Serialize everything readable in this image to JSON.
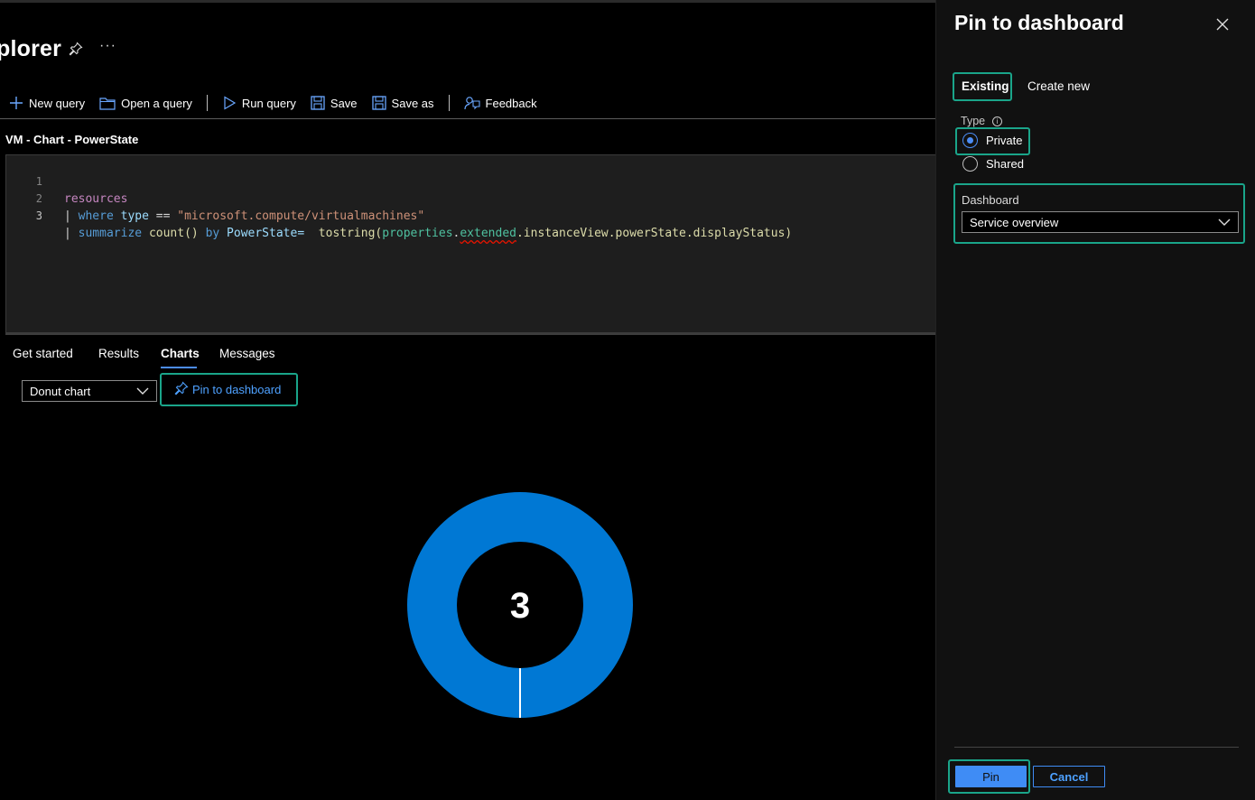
{
  "page": {
    "title": "plorer",
    "more_glyph": "···"
  },
  "toolbar": {
    "new_query": "New query",
    "open_query": "Open a query",
    "run_query": "Run query",
    "save": "Save",
    "save_as": "Save as",
    "feedback": "Feedback"
  },
  "query_tab": {
    "label": "VM - Chart - PowerState"
  },
  "editor": {
    "line_numbers": [
      "1",
      "2",
      "3"
    ],
    "line1": "resources",
    "line2": {
      "pipe": "|",
      "where": "where",
      "type": "type",
      "op": "==",
      "value": "\"microsoft.compute/virtualmachines\""
    },
    "line3": {
      "pipe": "|",
      "summarize": "summarize",
      "count": "count()",
      "by": "by",
      "alias": "PowerState=",
      "fn": "tostring(",
      "p1": "properties",
      "dot1": ".",
      "p2": "extended",
      "rest": ".instanceView.powerState.displayStatus)"
    }
  },
  "result_tabs": {
    "get_started": "Get started",
    "results": "Results",
    "charts": "Charts",
    "messages": "Messages",
    "active": "Charts"
  },
  "chart_controls": {
    "chart_type_value": "Donut chart",
    "pin_button": "Pin to dashboard"
  },
  "chart_data": {
    "type": "pie",
    "variant": "donut",
    "center_label": "3",
    "slices": [
      {
        "value": 3,
        "color": "#0078d4"
      }
    ]
  },
  "panel": {
    "title": "Pin to dashboard",
    "tabs": {
      "existing": "Existing",
      "create_new": "Create new",
      "active": "Existing"
    },
    "type_label": "Type",
    "type_options": {
      "private": "Private",
      "shared": "Shared",
      "selected": "Private"
    },
    "dashboard_label": "Dashboard",
    "dashboard_value": "Service overview",
    "pin_button": "Pin",
    "cancel_button": "Cancel"
  },
  "colors": {
    "accent": "#4c8df6",
    "highlight": "#1aa58a",
    "donut": "#0078d4"
  }
}
